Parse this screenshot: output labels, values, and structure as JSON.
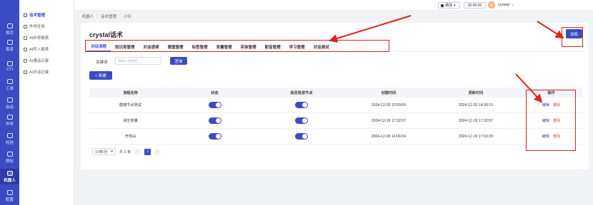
{
  "rail": {
    "items": [
      {
        "label": "首页",
        "icon": "home-icon"
      },
      {
        "label": "客资",
        "icon": "customers-icon"
      },
      {
        "label": "CTI",
        "icon": "cti-icon"
      },
      {
        "label": "工单",
        "icon": "ticket-icon"
      },
      {
        "label": "会话",
        "icon": "chat-icon"
      },
      {
        "label": "外呼",
        "icon": "phone-out-icon"
      },
      {
        "label": "短信",
        "icon": "sms-icon"
      },
      {
        "label": "质检",
        "icon": "inspection-icon"
      },
      {
        "label": "机器人",
        "icon": "robot-icon"
      },
      {
        "label": "配置",
        "icon": "settings-icon"
      }
    ]
  },
  "submenu": {
    "items": [
      {
        "label": "话术管理"
      },
      {
        "label": "外呼任务"
      },
      {
        "label": "AI外呼报表"
      },
      {
        "label": "AI呼入报表"
      },
      {
        "label": "AI通话记录"
      },
      {
        "label": "AI对话记录"
      }
    ]
  },
  "topbar": {
    "status": "离线",
    "timer": "00:00:00",
    "username": "crystal"
  },
  "breadcrumb": [
    "机器人",
    "话术管理",
    "详情"
  ],
  "page": {
    "title": "crystal话术",
    "train_label": "训练"
  },
  "tabs": [
    "对话流程",
    "知识库管理",
    "对话语境",
    "意图管理",
    "标签管理",
    "变量管理",
    "实体管理",
    "配音管理",
    "学习管理",
    "对话测试"
  ],
  "search": {
    "label": "关键词",
    "placeholder": "请输入关键词",
    "query_label": "查询"
  },
  "new_label": "+ 新建",
  "table": {
    "headers": [
      "流程名称",
      "状态",
      "是否是首节点",
      "创建时间",
      "更新时间",
      "操作"
    ],
    "rows": [
      {
        "name": "循環节点测试",
        "created": "2024-12-20 13:59:55",
        "updated": "2024-12-20 14:30:15",
        "edit": "编辑",
        "delete": "删除"
      },
      {
        "name": "清空变量",
        "created": "2024-12-19 17:32:57",
        "updated": "2024-12-19 17:32:57",
        "edit": "编辑",
        "delete": "删除"
      },
      {
        "name": "开场白",
        "created": "2024-12-09 14:06:04",
        "updated": "2024-12-19 17:53:20",
        "edit": "编辑",
        "delete": "删除"
      }
    ]
  },
  "pagination": {
    "page_size": "10条/页",
    "total": "共 3 条",
    "prev": "‹",
    "current": "1",
    "next": "›"
  },
  "colors": {
    "primary": "#3a4bc4",
    "highlight": "#e02020",
    "danger": "#e04848"
  }
}
